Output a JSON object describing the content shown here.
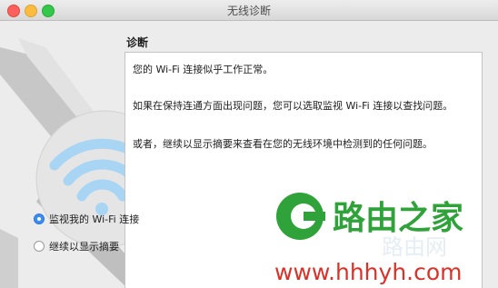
{
  "window": {
    "title": "无线诊断"
  },
  "section": {
    "title": "诊断"
  },
  "content": {
    "line1": "您的 Wi-Fi 连接似乎工作正常。",
    "line2": "如果在保持连通方面出现问题，您可以选取监视 Wi-Fi 连接以查找问题。",
    "line3": "或者，继续以显示摘要来查看在您的无线环境中检测到的任何问题。"
  },
  "options": [
    {
      "label": "监视我的 Wi-Fi 连接",
      "selected": true
    },
    {
      "label": "继续以显示摘要",
      "selected": false
    }
  ],
  "watermark": {
    "brand": "路由之家",
    "url": "www.hhhyh.com",
    "ghost": "路由网"
  },
  "colors": {
    "accent": "#3b8cf3",
    "watermark_green": "#2fa33a",
    "watermark_red": "#d9322a"
  },
  "icons": [
    "wifi-icon",
    "cable-graphic"
  ]
}
